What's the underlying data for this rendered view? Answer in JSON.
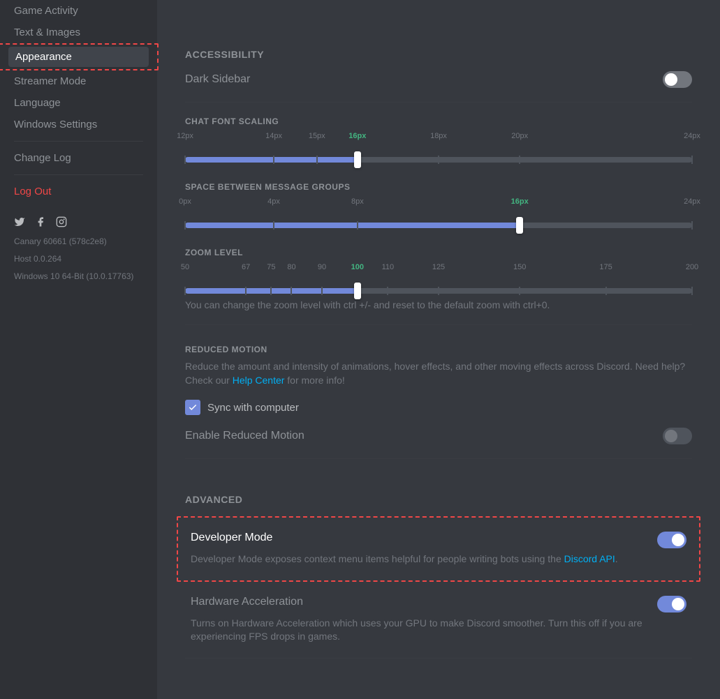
{
  "sidebar": {
    "items": [
      {
        "label": "Game Activity"
      },
      {
        "label": "Text & Images"
      },
      {
        "label": "Appearance"
      },
      {
        "label": "Streamer Mode"
      },
      {
        "label": "Language"
      },
      {
        "label": "Windows Settings"
      }
    ],
    "change_log": "Change Log",
    "log_out": "Log Out",
    "version": {
      "line1": "Canary 60661 (578c2e8)",
      "line2": "Host 0.0.264",
      "line3": "Windows 10 64-Bit (10.0.17763)"
    }
  },
  "accessibility": {
    "title": "ACCESSIBILITY",
    "dark_sidebar": "Dark Sidebar",
    "chat_font_scaling": {
      "title": "CHAT FONT SCALING",
      "ticks": [
        "12px",
        "14px",
        "15px",
        "16px",
        "18px",
        "20px",
        "24px"
      ],
      "positions": [
        0,
        17.5,
        26,
        34,
        50,
        66,
        100
      ],
      "current_index": 3,
      "fill_percent": 34
    },
    "space_between": {
      "title": "SPACE BETWEEN MESSAGE GROUPS",
      "ticks": [
        "0px",
        "4px",
        "8px",
        "16px",
        "24px"
      ],
      "positions": [
        0,
        17.5,
        34,
        66,
        100
      ],
      "current_index": 3,
      "fill_percent": 66
    },
    "zoom_level": {
      "title": "ZOOM LEVEL",
      "ticks": [
        "50",
        "67",
        "75",
        "80",
        "90",
        "100",
        "110",
        "125",
        "150",
        "175",
        "200"
      ],
      "positions": [
        0,
        12,
        17,
        21,
        27,
        34,
        40,
        50,
        66,
        83,
        100
      ],
      "current_index": 5,
      "fill_percent": 34,
      "help": "You can change the zoom level with ctrl +/- and reset to the default zoom with ctrl+0."
    },
    "reduced_motion": {
      "title": "REDUCED MOTION",
      "desc_part1": "Reduce the amount and intensity of animations, hover effects, and other moving effects across Discord. Need help? Check our ",
      "link": "Help Center",
      "desc_part2": " for more info!",
      "sync_label": "Sync with computer",
      "enable_label": "Enable Reduced Motion"
    }
  },
  "advanced": {
    "title": "ADVANCED",
    "developer_mode": {
      "label": "Developer Mode",
      "desc_part1": "Developer Mode exposes context menu items helpful for people writing bots using the ",
      "link": "Discord API",
      "desc_part2": "."
    },
    "hardware_accel": {
      "label": "Hardware Acceleration",
      "desc": "Turns on Hardware Acceleration which uses your GPU to make Discord smoother. Turn this off if you are experiencing FPS drops in games."
    }
  }
}
